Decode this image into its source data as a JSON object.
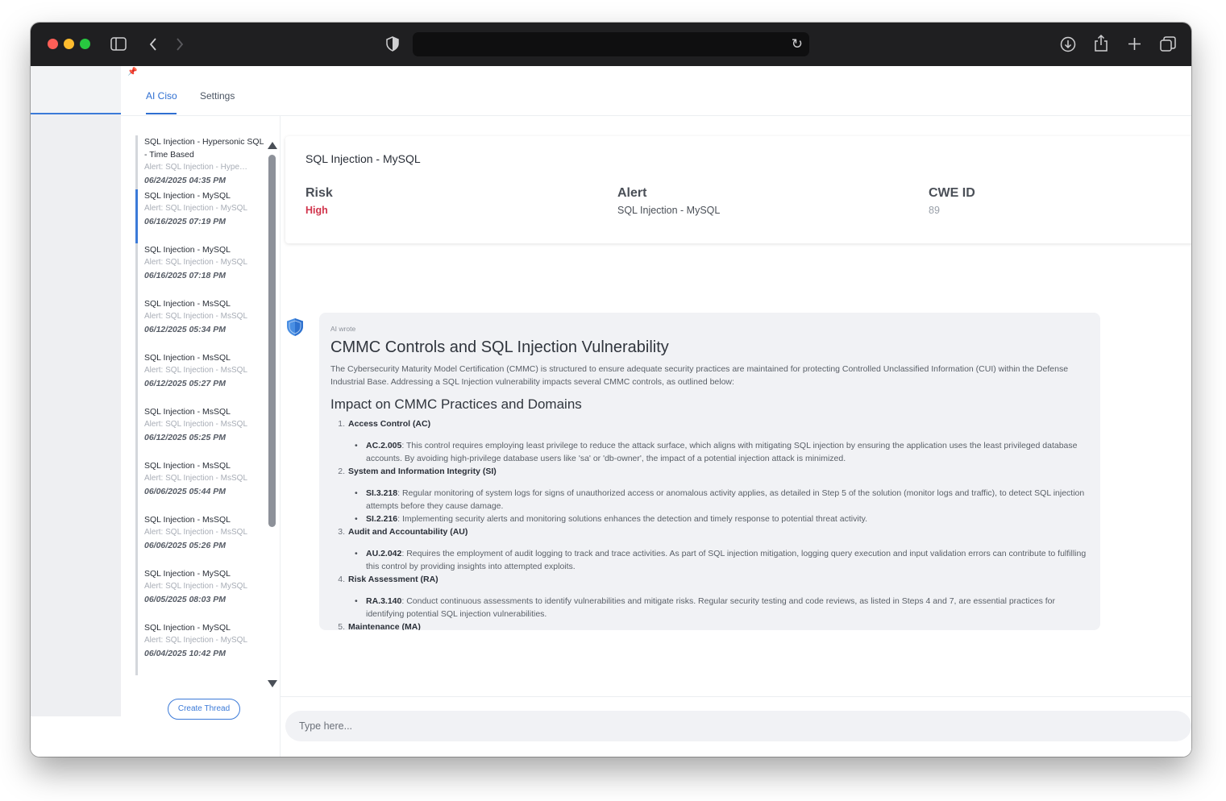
{
  "browser": {
    "sidebar_icon": "sidebar-toggle-icon",
    "back_icon": "chevron-left-icon",
    "forward_icon": "chevron-right-icon",
    "shield_icon": "shield-icon",
    "url": "",
    "reload_icon": "reload-icon",
    "download_icon": "download-icon",
    "share_icon": "share-icon",
    "newtab_icon": "plus-icon",
    "tabs_icon": "tab-overview-icon"
  },
  "tabs": [
    {
      "label": "AI Ciso",
      "active": true
    },
    {
      "label": "Settings",
      "active": false
    }
  ],
  "threads": [
    {
      "title": "SQL Injection - Hypersonic SQL - Time Based",
      "alert": "Alert: SQL Injection - Hypersonic SQL - Time Based",
      "date": "06/24/2025 04:35 PM",
      "selected": false
    },
    {
      "title": "SQL Injection - MySQL",
      "alert": "Alert: SQL Injection - MySQL",
      "date": "06/16/2025 07:19 PM",
      "selected": true
    },
    {
      "title": "SQL Injection - MySQL",
      "alert": "Alert: SQL Injection - MySQL",
      "date": "06/16/2025 07:18 PM",
      "selected": false
    },
    {
      "title": "SQL Injection - MsSQL",
      "alert": "Alert: SQL Injection - MsSQL",
      "date": "06/12/2025 05:34 PM",
      "selected": false
    },
    {
      "title": "SQL Injection - MsSQL",
      "alert": "Alert: SQL Injection - MsSQL",
      "date": "06/12/2025 05:27 PM",
      "selected": false
    },
    {
      "title": "SQL Injection - MsSQL",
      "alert": "Alert: SQL Injection - MsSQL",
      "date": "06/12/2025 05:25 PM",
      "selected": false
    },
    {
      "title": "SQL Injection - MsSQL",
      "alert": "Alert: SQL Injection - MsSQL",
      "date": "06/06/2025 05:44 PM",
      "selected": false
    },
    {
      "title": "SQL Injection - MsSQL",
      "alert": "Alert: SQL Injection - MsSQL",
      "date": "06/06/2025 05:26 PM",
      "selected": false
    },
    {
      "title": "SQL Injection - MySQL",
      "alert": "Alert: SQL Injection - MySQL",
      "date": "06/05/2025 08:03 PM",
      "selected": false
    },
    {
      "title": "SQL Injection - MySQL",
      "alert": "Alert: SQL Injection - MySQL",
      "date": "06/04/2025 10:42 PM",
      "selected": false
    }
  ],
  "create_thread_label": "Create Thread",
  "alert_card": {
    "title": "SQL Injection - MySQL",
    "risk_label": "Risk",
    "risk_value": "High",
    "alert_label": "Alert",
    "alert_value": "SQL Injection - MySQL",
    "cwe_label": "CWE ID",
    "cwe_value": "89",
    "risk_color": "#d1344c"
  },
  "ai_message": {
    "author": "AI wrote",
    "heading": "CMMC Controls and SQL Injection Vulnerability",
    "intro": "The Cybersecurity Maturity Model Certification (CMMC) is structured to ensure adequate security practices are maintained for protecting Controlled Unclassified Information (CUI) within the Defense Industrial Base. Addressing a SQL Injection vulnerability impacts several CMMC controls, as outlined below:",
    "subheading": "Impact on CMMC Practices and Domains",
    "domains": [
      {
        "num": "1.",
        "name": "Access Control (AC)",
        "items": [
          {
            "code": "AC.2.005",
            "text": ": This control requires employing least privilege to reduce the attack surface, which aligns with mitigating SQL injection by ensuring the application uses the least privileged database accounts. By avoiding high-privilege database users like 'sa' or 'db-owner', the impact of a potential injection attack is minimized."
          }
        ]
      },
      {
        "num": "2.",
        "name": "System and Information Integrity (SI)",
        "items": [
          {
            "code": "SI.3.218",
            "text": ": Regular monitoring of system logs for signs of unauthorized access or anomalous activity applies, as detailed in Step 5 of the solution (monitor logs and traffic), to detect SQL injection attempts before they cause damage."
          },
          {
            "code": "SI.2.216",
            "text": ": Implementing security alerts and monitoring solutions enhances the detection and timely response to potential threat activity."
          }
        ]
      },
      {
        "num": "3.",
        "name": "Audit and Accountability (AU)",
        "items": [
          {
            "code": "AU.2.042",
            "text": ": Requires the employment of audit logging to track and trace activities. As part of SQL injection mitigation, logging query execution and input validation errors can contribute to fulfilling this control by providing insights into attempted exploits."
          }
        ]
      },
      {
        "num": "4.",
        "name": "Risk Assessment (RA)",
        "items": [
          {
            "code": "RA.3.140",
            "text": ": Conduct continuous assessments to identify vulnerabilities and mitigate risks. Regular security testing and code reviews, as listed in Steps 4 and 7, are essential practices for identifying potential SQL injection vulnerabilities."
          }
        ]
      },
      {
        "num": "5.",
        "name": "Maintenance (MA)",
        "items": []
      }
    ]
  },
  "composer": {
    "placeholder": "Type here..."
  }
}
